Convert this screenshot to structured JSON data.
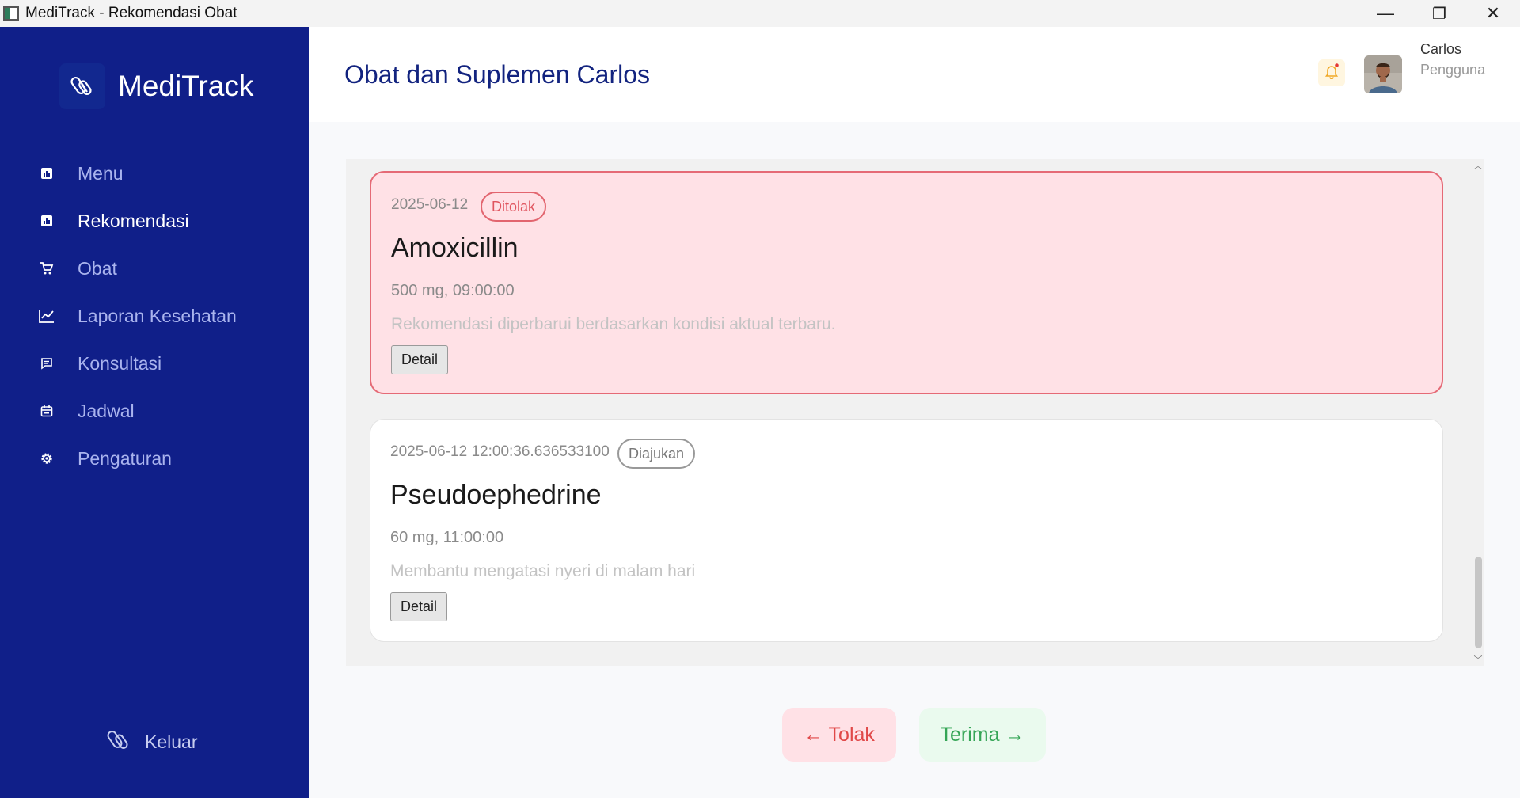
{
  "window": {
    "title": "MediTrack - Rekomendasi Obat",
    "controls": {
      "minimize": "—",
      "restore": "❐",
      "close": "✕"
    }
  },
  "sidebar": {
    "brand": "MediTrack",
    "items": [
      {
        "label": "Menu",
        "icon": "chart-icon",
        "active": false
      },
      {
        "label": "Rekomendasi",
        "icon": "chart-icon",
        "active": true
      },
      {
        "label": "Obat",
        "icon": "cart-icon",
        "active": false
      },
      {
        "label": "Laporan Kesehatan",
        "icon": "line-chart-icon",
        "active": false
      },
      {
        "label": "Konsultasi",
        "icon": "message-icon",
        "active": false
      },
      {
        "label": "Jadwal",
        "icon": "calendar-icon",
        "active": false
      },
      {
        "label": "Pengaturan",
        "icon": "gear-icon",
        "active": false
      }
    ],
    "logout": "Keluar"
  },
  "header": {
    "title": "Obat dan Suplemen Carlos",
    "user": {
      "name": "Carlos",
      "role": "Pengguna"
    }
  },
  "recommendations": [
    {
      "date": "2025-06-12",
      "status": "Ditolak",
      "name": "Amoxicillin",
      "dose": "500 mg, 09:00:00",
      "note": "Rekomendasi diperbarui berdasarkan kondisi aktual terbaru.",
      "detail_label": "Detail"
    },
    {
      "date": "2025-06-12 12:00:36.636533100",
      "status": "Diajukan",
      "name": "Pseudoephedrine",
      "dose": "60 mg, 11:00:00",
      "note": "Membantu mengatasi nyeri di malam hari",
      "detail_label": "Detail"
    }
  ],
  "actions": {
    "reject": "← Tolak",
    "accept": "Terima →"
  },
  "colors": {
    "sidebar": "#101f89",
    "title": "#12237f",
    "rejected_bg": "#ffe1e6",
    "rejected_border": "#e56a76",
    "accept_text": "#35a556",
    "reject_text": "#e04848"
  }
}
